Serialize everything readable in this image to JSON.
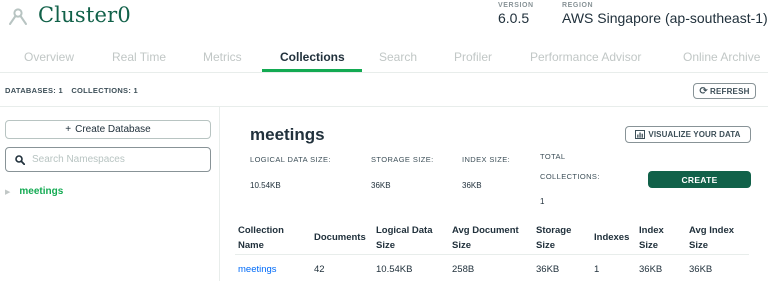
{
  "header": {
    "cluster_name": "Cluster0",
    "version_label": "VERSION",
    "version_value": "6.0.5",
    "region_label": "REGION",
    "region_value": "AWS Singapore (ap-southeast-1)"
  },
  "tabs": [
    {
      "label": "Overview",
      "active": false
    },
    {
      "label": "Real Time",
      "active": false
    },
    {
      "label": "Metrics",
      "active": false
    },
    {
      "label": "Collections",
      "active": true
    },
    {
      "label": "Search",
      "active": false
    },
    {
      "label": "Profiler",
      "active": false
    },
    {
      "label": "Performance Advisor",
      "active": false
    },
    {
      "label": "Online Archive",
      "active": false
    }
  ],
  "stats_bar": {
    "databases": "DATABASES: 1",
    "collections": "COLLECTIONS: 1"
  },
  "refresh_label": "REFRESH",
  "sidebar": {
    "create_database_label": "Create Database",
    "search_placeholder": "Search Namespaces",
    "databases": [
      "meetings"
    ]
  },
  "main": {
    "db_title": "meetings",
    "visualize_label": "VISUALIZE YOUR DATA",
    "stats": {
      "logical_data_size_label": "LOGICAL DATA SIZE:",
      "logical_data_size_value": "10.54KB",
      "storage_size_label": "STORAGE SIZE:",
      "storage_size_value": "36KB",
      "index_size_label": "INDEX SIZE:",
      "index_size_value": "36KB",
      "total_collections_label_1": "TOTAL",
      "total_collections_label_2": "COLLECTIONS:",
      "total_collections_value": "1"
    },
    "create_label": "CREATE",
    "table": {
      "headers": [
        [
          "Collection",
          "Name"
        ],
        [
          "Documents",
          ""
        ],
        [
          "Logical Data",
          "Size"
        ],
        [
          "Avg Document",
          "Size"
        ],
        [
          "Storage",
          "Size"
        ],
        [
          "Indexes",
          ""
        ],
        [
          "Index",
          "Size"
        ],
        [
          "Avg Index",
          "Size"
        ]
      ],
      "rows": [
        [
          "meetings",
          "42",
          "10.54KB",
          "258B",
          "36KB",
          "1",
          "36KB",
          "36KB"
        ]
      ]
    }
  },
  "colors": {
    "brand_green": "#13aa52",
    "dark_green": "#116149",
    "link_blue": "#016bf8"
  }
}
